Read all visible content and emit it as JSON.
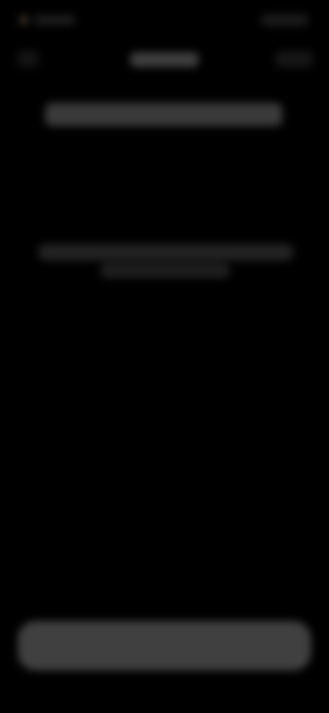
{
  "colors": {
    "background": "#000000",
    "placeholder_text": "#3a3a3a",
    "button_fill": "#404040"
  },
  "screen": {
    "obscured": true
  },
  "status_bar": {
    "time": "",
    "indicators": ""
  },
  "nav": {
    "back_icon": "chevron-left-icon",
    "title": "",
    "action": ""
  },
  "main": {
    "headline": "",
    "body_line_1": "",
    "body_line_2": ""
  },
  "footer": {
    "primary_button_label": ""
  }
}
